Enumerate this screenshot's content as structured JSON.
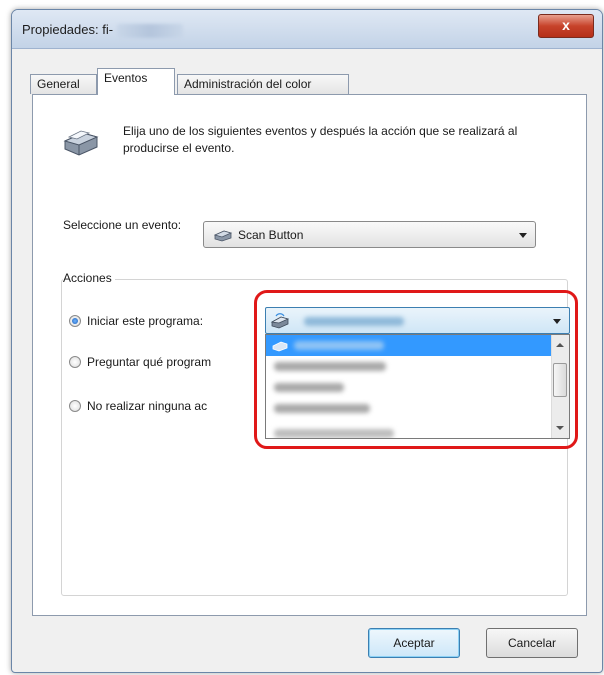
{
  "window": {
    "title": "Propiedades: fi-",
    "close_label": "x"
  },
  "tabs": [
    {
      "label": "General",
      "active": false
    },
    {
      "label": "Eventos",
      "active": true
    },
    {
      "label": "Administración del color",
      "active": false
    }
  ],
  "events_tab": {
    "description": "Elija uno de los siguientes eventos y después la acción que se realizará al producirse el evento.",
    "select_event_label": "Seleccione un evento:",
    "selected_event": "Scan Button"
  },
  "actions": {
    "group_label": "Acciones",
    "options": [
      {
        "label": "Iniciar este programa:",
        "checked": true
      },
      {
        "label": "Preguntar qué program",
        "checked": false
      },
      {
        "label": "No realizar ninguna ac",
        "checked": false
      }
    ]
  },
  "program_dropdown": {
    "open": true,
    "selected_index": 0,
    "items_count_visible": 5
  },
  "buttons": {
    "ok": "Aceptar",
    "cancel": "Cancelar"
  },
  "colors": {
    "highlight": "#e01818",
    "selection": "#3399ff",
    "title_bar": "#c3d3e7"
  }
}
